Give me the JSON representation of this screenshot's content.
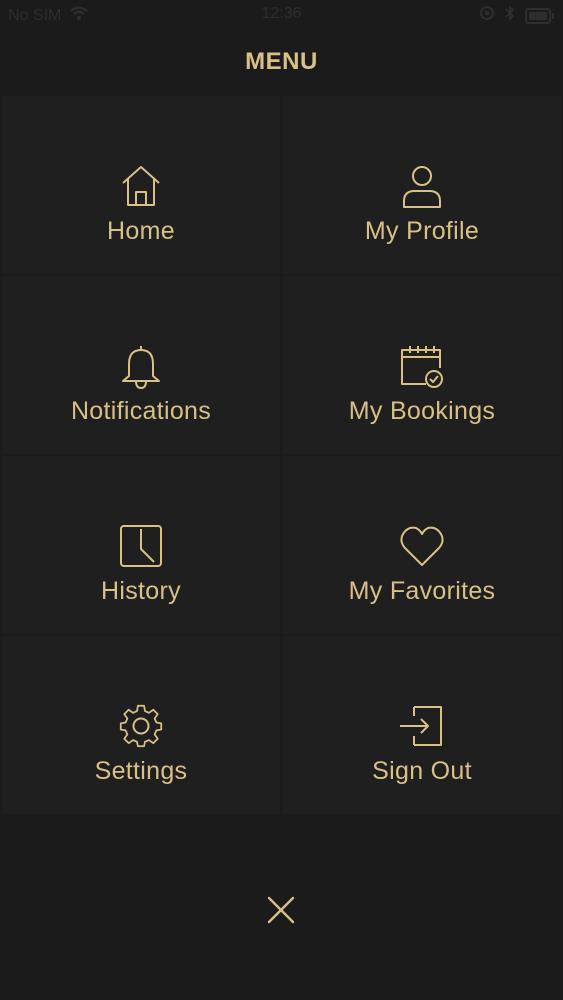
{
  "status_bar": {
    "carrier": "No SIM",
    "time": "12:36"
  },
  "menu": {
    "title": "MENU",
    "items": [
      {
        "label": "Home",
        "icon": "home-icon"
      },
      {
        "label": "My Profile",
        "icon": "user-icon"
      },
      {
        "label": "Notifications",
        "icon": "bell-icon"
      },
      {
        "label": "My Bookings",
        "icon": "calendar-check-icon"
      },
      {
        "label": "History",
        "icon": "clock-icon"
      },
      {
        "label": "My Favorites",
        "icon": "heart-icon"
      },
      {
        "label": "Settings",
        "icon": "gear-icon"
      },
      {
        "label": "Sign Out",
        "icon": "sign-out-icon"
      }
    ],
    "close_icon": "close-icon"
  },
  "colors": {
    "background": "#1b1b1b",
    "tile": "#1f1f1f",
    "accent": "#d8c087",
    "status_text": "#2e2e2e"
  }
}
